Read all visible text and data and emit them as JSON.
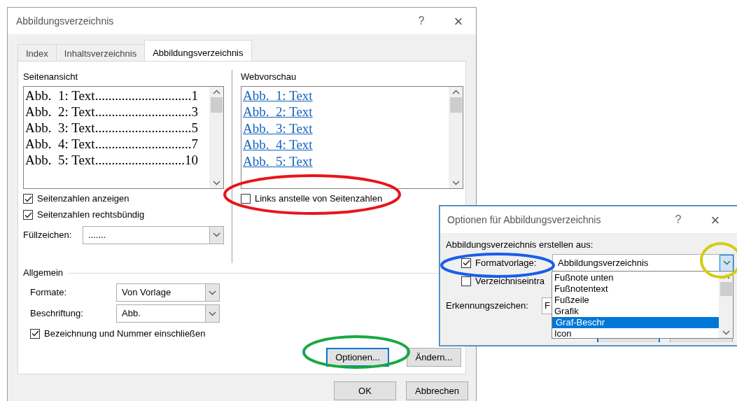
{
  "main_dialog": {
    "title": "Abbildungsverzeichnis",
    "help": "?",
    "close": "×",
    "tabs": [
      {
        "label": "Index",
        "selected": false
      },
      {
        "label": "Inhaltsverzeichnis",
        "selected": false
      },
      {
        "label": "Abbildungsverzeichnis",
        "selected": true
      }
    ],
    "print_preview": {
      "label": "Seitenansicht",
      "lines": [
        "Abb.  1: Text.............................1",
        "Abb.  2: Text.............................3",
        "Abb.  3: Text.............................5",
        "Abb.  4: Text.............................7",
        "Abb.  5: Text...........................10"
      ]
    },
    "web_preview": {
      "label": "Webvorschau",
      "links": [
        "Abb.  1: Text",
        "Abb.  2: Text",
        "Abb.  3: Text",
        "Abb.  4: Text",
        "Abb.  5: Text"
      ]
    },
    "options": [
      {
        "label": "Seitenzahlen anzeigen",
        "checked": true
      },
      {
        "label": "Seitenzahlen rechtsbündig",
        "checked": true
      }
    ],
    "links_option": {
      "label": "Links anstelle von Seitenzahlen",
      "checked": false
    },
    "fill_char": {
      "label": "Füllzeichen:",
      "value": "......."
    },
    "general": {
      "title": "Allgemein",
      "fields": [
        {
          "label": "Formate:",
          "value": "Von Vorlage"
        },
        {
          "label": "Beschriftung:",
          "value": "Abb."
        }
      ],
      "include": {
        "label": "Bezeichnung und Nummer einschließen",
        "checked": true
      }
    },
    "panel_buttons": [
      {
        "label": "Optionen...",
        "focused": true
      },
      {
        "label": "Ändern...",
        "focused": false
      }
    ],
    "buttons": [
      "OK",
      "Abbrechen"
    ]
  },
  "options_dialog": {
    "title": "Optionen für Abbildungsverzeichnis",
    "help": "?",
    "close": "×",
    "group_label": "Abbildungsverzeichnis erstellen aus:",
    "style": {
      "label": "Formatvorlage:",
      "checked": true,
      "value": "Abbildungsverzeichnis",
      "expanded": true,
      "options": [
        {
          "label": "Fußnote unten",
          "selected": false
        },
        {
          "label": "Fußnotentext",
          "selected": false
        },
        {
          "label": "Fußzeile",
          "selected": false
        },
        {
          "label": "Grafik",
          "selected": false
        },
        {
          "label": "Graf-Beschr",
          "selected": true
        },
        {
          "label": "Icon",
          "selected": false
        }
      ]
    },
    "entries": {
      "label": "Verzeichniseintra",
      "checked": false
    },
    "identifier": {
      "label": "Erkennungszeichen:",
      "value": "F"
    }
  },
  "annotations": [
    {
      "color": "#e8141b"
    },
    {
      "color": "#1a5ee8"
    },
    {
      "color": "#d4cc10"
    },
    {
      "color": "#17a843"
    }
  ]
}
